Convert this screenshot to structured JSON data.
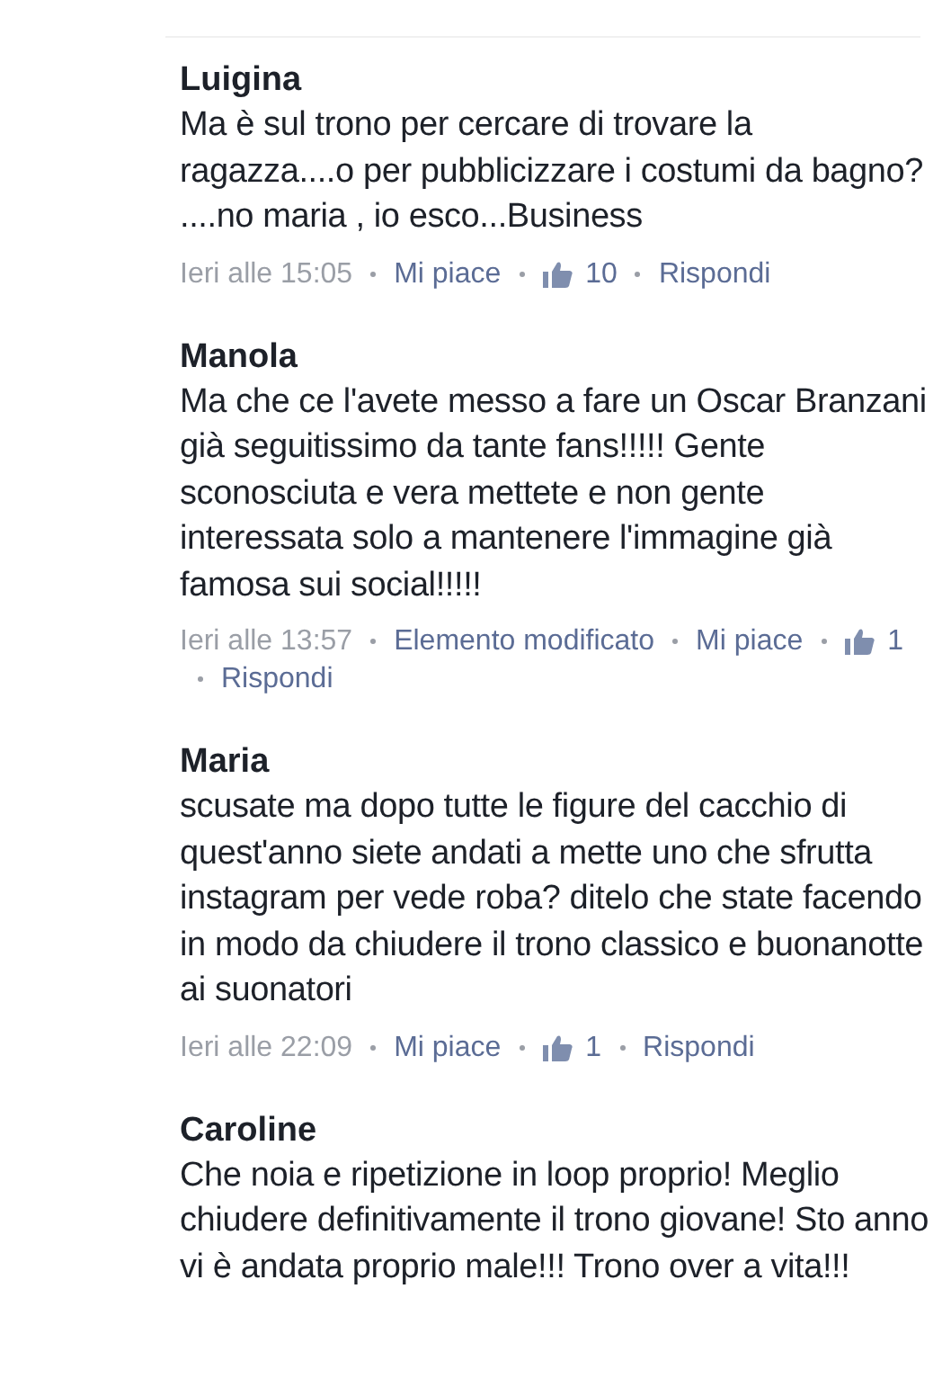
{
  "comments": [
    {
      "author": "Luigina",
      "body": "Ma è sul trono per cercare di trovare la ragazza....o per pubblicizzare i costumi da bagno? ....no maria , io esco...Business",
      "meta": [
        {
          "kind": "time",
          "text": "Ieri alle 15:05"
        },
        {
          "kind": "link",
          "text": "Mi piace"
        },
        {
          "kind": "likes",
          "text": "10"
        },
        {
          "kind": "link",
          "text": "Rispondi"
        }
      ]
    },
    {
      "author": "Manola",
      "body": "Ma che ce l'avete messo a fare un Oscar Branzani già seguitissimo da tante fans!!!!! Gente sconosciuta e vera mettete e non gente  interessata solo a  mantenere l'immagine già famosa sui social!!!!!",
      "meta": [
        {
          "kind": "time",
          "text": "Ieri alle 13:57"
        },
        {
          "kind": "edited",
          "text": "Elemento modificato"
        },
        {
          "kind": "link",
          "text": "Mi piace"
        },
        {
          "kind": "likes",
          "text": "1"
        },
        {
          "kind": "link",
          "text": "Rispondi"
        }
      ]
    },
    {
      "author": "Maria",
      "body": "scusate ma dopo tutte le figure del cacchio di quest'anno siete andati a mette uno che sfrutta instagram per vede roba? ditelo che state facendo in modo da chiudere il trono classico e buonanotte ai suonatori",
      "meta": [
        {
          "kind": "time",
          "text": "Ieri alle 22:09"
        },
        {
          "kind": "link",
          "text": "Mi piace"
        },
        {
          "kind": "likes",
          "text": "1"
        },
        {
          "kind": "link",
          "text": "Rispondi"
        }
      ]
    },
    {
      "author": "Caroline",
      "body": "Che noia e ripetizione in loop proprio! Meglio chiudere definitivamente il trono giovane! Sto anno vi è andata proprio male!!! Trono over a vita!!!"
    }
  ]
}
